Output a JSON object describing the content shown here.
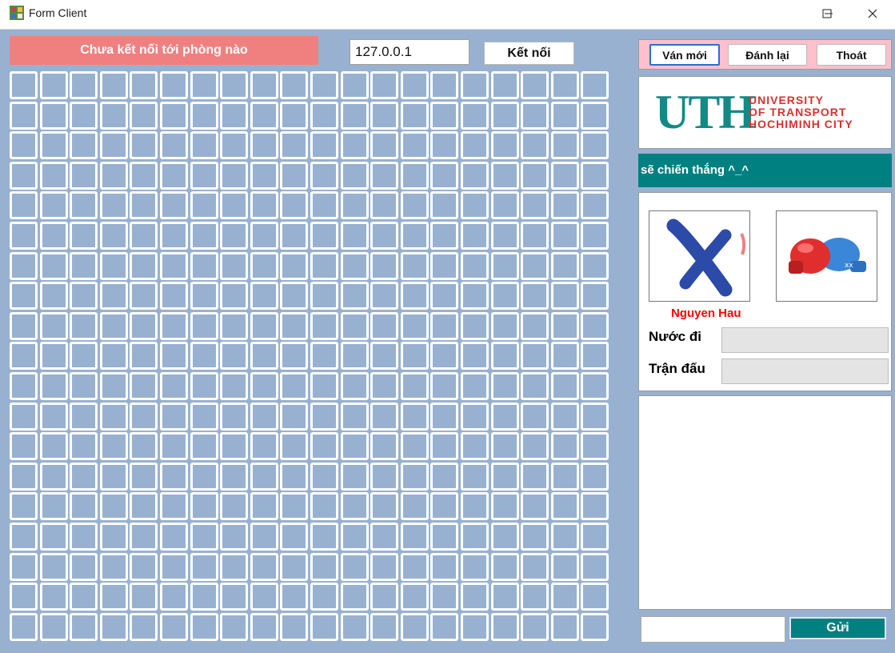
{
  "window": {
    "title": "Form Client"
  },
  "status_banner": "Chưa kết nối tới phòng nào",
  "connection": {
    "ip_value": "127.0.0.1",
    "connect_label": "Kết nối"
  },
  "board": {
    "columns": 20,
    "rows": 19
  },
  "menu": {
    "new_game": "Ván mới",
    "replay": "Đánh lại",
    "quit": "Thoát"
  },
  "logo": {
    "mark": "UTH",
    "line1": "UNIVERSITY",
    "line2": "OF TRANSPORT",
    "line3": "HOCHIMINH CITY"
  },
  "marquee": "sẽ chiến thắng ^_^",
  "player": {
    "name": "Nguyen Hau",
    "move_label": "Nước đi",
    "match_label": "Trận đấu",
    "move_value": "",
    "match_value": ""
  },
  "chat": {
    "input_value": "",
    "send_label": "Gửi"
  },
  "colors": {
    "background": "#98b1d0",
    "banner": "#f08080",
    "teal": "#008080",
    "menu_bg": "#ffc0cb"
  },
  "icons": [
    "app-icon",
    "minimize-icon",
    "maximize-icon",
    "close-icon",
    "x-mark-icon",
    "boxing-gloves-icon"
  ]
}
